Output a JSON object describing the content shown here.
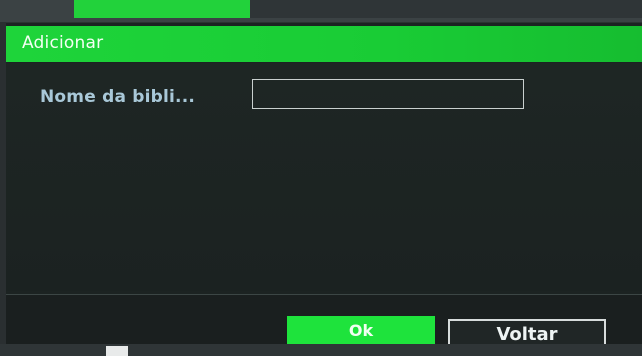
{
  "dialog": {
    "title": "Adicionar",
    "field": {
      "label": "Nome da bibli...",
      "value": ""
    },
    "buttons": {
      "ok_label": "Ok",
      "back_label": "Voltar"
    }
  },
  "colors": {
    "accent": "#1ed43a",
    "dialog_bg": "#1c2322",
    "label_text": "#a9c8d8"
  }
}
